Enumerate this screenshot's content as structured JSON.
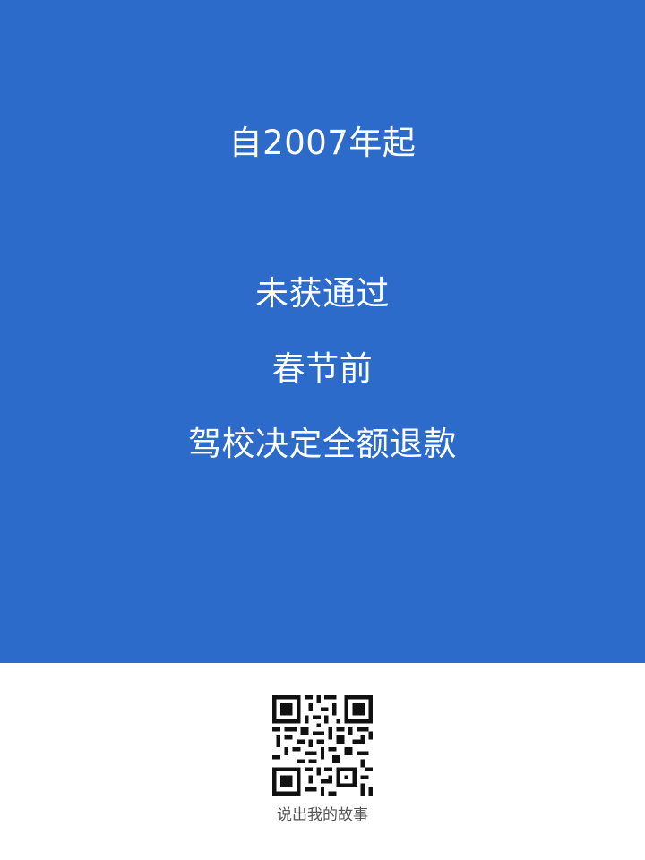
{
  "poster": {
    "lines": [
      "自2007年起",
      "未获通过",
      "春节前",
      "驾校决定全额退款"
    ],
    "background": "#2c6bc9",
    "text_color": "#ffffff"
  },
  "footer": {
    "qr_icon": "qr-code-icon",
    "caption": "说出我的故事"
  }
}
